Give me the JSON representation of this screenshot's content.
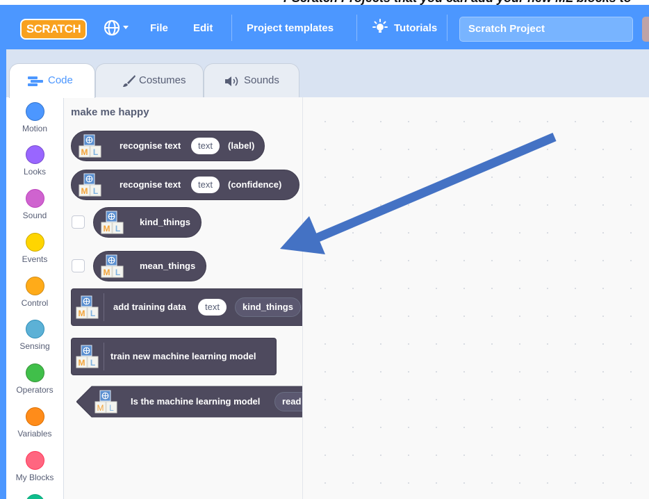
{
  "menubar": {
    "logo": "SCRATCH",
    "file": "File",
    "edit": "Edit",
    "project_templates": "Project templates",
    "tutorials": "Tutorials",
    "project_title": "Scratch Project"
  },
  "tabs": [
    {
      "label": "Code",
      "active": true
    },
    {
      "label": "Costumes",
      "active": false
    },
    {
      "label": "Sounds",
      "active": false
    }
  ],
  "categories": [
    {
      "label": "Motion",
      "color": "#4c97ff"
    },
    {
      "label": "Looks",
      "color": "#9966ff"
    },
    {
      "label": "Sound",
      "color": "#cf63cf"
    },
    {
      "label": "Events",
      "color": "#ffd500"
    },
    {
      "label": "Control",
      "color": "#ffab19"
    },
    {
      "label": "Sensing",
      "color": "#5cb1d6"
    },
    {
      "label": "Operators",
      "color": "#40bf4a"
    },
    {
      "label": "Variables",
      "color": "#ff8c1a"
    },
    {
      "label": "My Blocks",
      "color": "#ff6680"
    }
  ],
  "palette": {
    "section_title": "make me happy",
    "recognise_label": {
      "text": "recognise text",
      "input": "text",
      "suffix": "(label)"
    },
    "recognise_confidence": {
      "text": "recognise text",
      "input": "text",
      "suffix": "(confidence)"
    },
    "kind_things": "kind_things",
    "mean_things": "mean_things",
    "add_training": {
      "text": "add training data",
      "input": "text",
      "label": "kind_things"
    },
    "train_model": "train new machine learning model",
    "is_ready": {
      "text": "Is the machine learning model",
      "label": "read"
    }
  },
  "ml_icon": {
    "letters": [
      "M",
      "L"
    ]
  },
  "colors": {
    "menubar": "#4c97ff",
    "extension_block": "#4e4a5e",
    "annotation_arrow": "#4472c4"
  }
}
